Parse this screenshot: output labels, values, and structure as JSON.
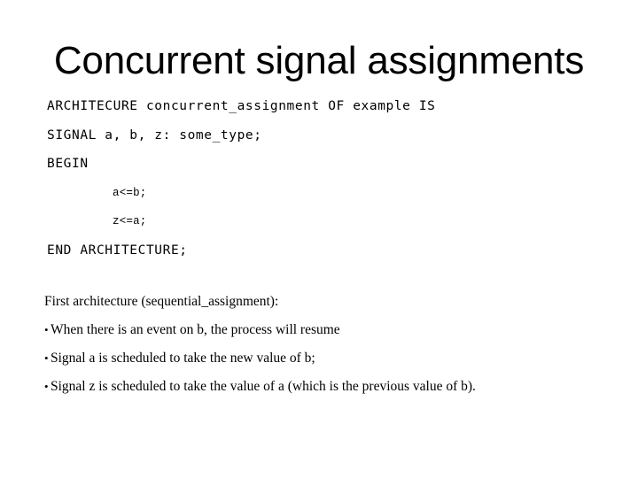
{
  "slide": {
    "title": "Concurrent signal assignments",
    "background_color": "#ffffff",
    "text_color": "#000000",
    "code": {
      "lines": [
        {
          "text": "ARCHITECURE concurrent_assignment OF example IS",
          "indented": false
        },
        {
          "text": "SIGNAL a, b, z: some_type;",
          "indented": false
        },
        {
          "text": "BEGIN",
          "indented": false
        },
        {
          "text": "a<=b;",
          "indented": true
        },
        {
          "text": "z<=a;",
          "indented": true
        },
        {
          "text": "END ARCHITECTURE;",
          "indented": false
        }
      ]
    },
    "body": {
      "heading": "First architecture (sequential_assignment):",
      "bullet_mark": "•",
      "bullets": [
        "When there is an event on b, the process will resume",
        "Signal a is scheduled to take the new value of b;",
        "Signal z is scheduled to take the value of a (which is the previous value of b)."
      ]
    }
  }
}
